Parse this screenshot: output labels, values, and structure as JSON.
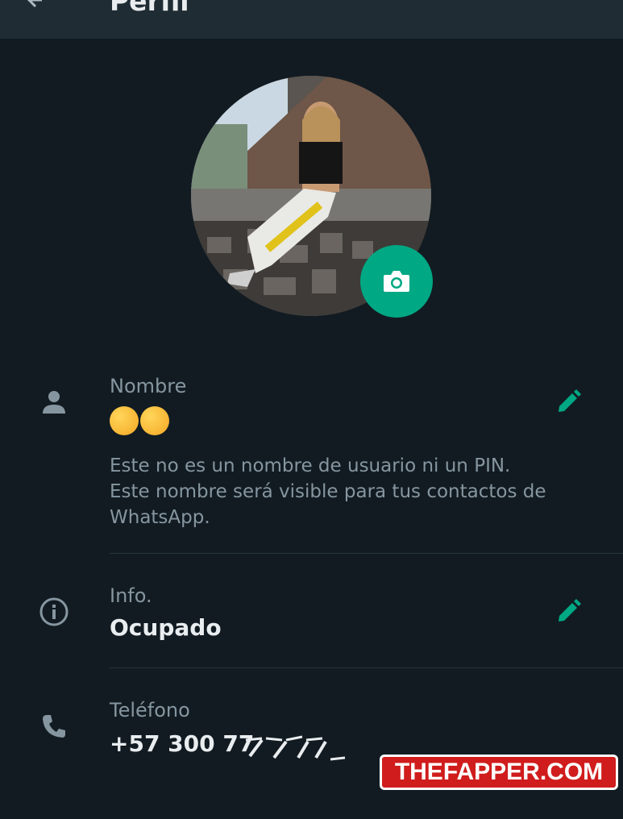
{
  "appbar": {
    "title": "Perfil",
    "back_icon": "arrow-back-icon"
  },
  "profile": {
    "photo_icon": "camera-icon",
    "accent": "#00a884"
  },
  "name_section": {
    "icon": "person-icon",
    "label": "Nombre",
    "value_emoji": "😘😘",
    "description_lines": [
      "Este no es un nombre de usuario ni un PIN.",
      "Este nombre será visible para tus contactos de",
      "WhatsApp."
    ],
    "edit_icon": "pencil-icon"
  },
  "info_section": {
    "icon": "info-icon",
    "label": "Info.",
    "value": "Ocupado",
    "edit_icon": "pencil-icon"
  },
  "phone_section": {
    "icon": "phone-icon",
    "label": "Teléfono",
    "value": "+57 300 77"
  },
  "watermark": {
    "text": "THEFAPPER.COM"
  }
}
